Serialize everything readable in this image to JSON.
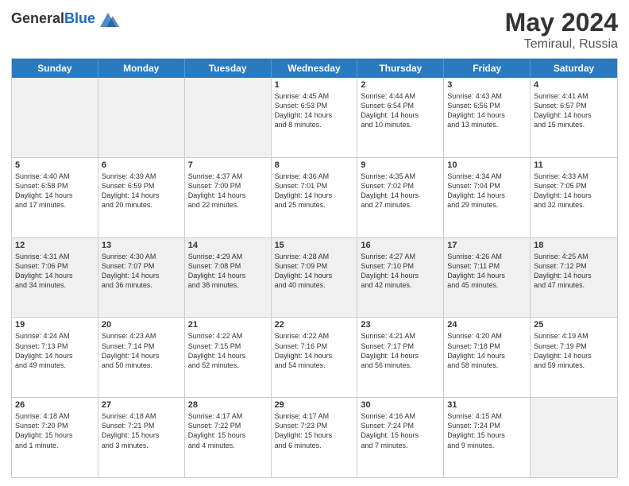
{
  "header": {
    "logo_line1": "General",
    "logo_line2": "Blue",
    "title": "May 2024",
    "location": "Temiraul, Russia"
  },
  "days_of_week": [
    "Sunday",
    "Monday",
    "Tuesday",
    "Wednesday",
    "Thursday",
    "Friday",
    "Saturday"
  ],
  "weeks": [
    [
      {
        "day": "",
        "info": "",
        "shaded": true
      },
      {
        "day": "",
        "info": "",
        "shaded": true
      },
      {
        "day": "",
        "info": "",
        "shaded": true
      },
      {
        "day": "1",
        "info": "Sunrise: 4:45 AM\nSunset: 6:53 PM\nDaylight: 14 hours\nand 8 minutes.",
        "shaded": false
      },
      {
        "day": "2",
        "info": "Sunrise: 4:44 AM\nSunset: 6:54 PM\nDaylight: 14 hours\nand 10 minutes.",
        "shaded": false
      },
      {
        "day": "3",
        "info": "Sunrise: 4:43 AM\nSunset: 6:56 PM\nDaylight: 14 hours\nand 13 minutes.",
        "shaded": false
      },
      {
        "day": "4",
        "info": "Sunrise: 4:41 AM\nSunset: 6:57 PM\nDaylight: 14 hours\nand 15 minutes.",
        "shaded": false
      }
    ],
    [
      {
        "day": "5",
        "info": "Sunrise: 4:40 AM\nSunset: 6:58 PM\nDaylight: 14 hours\nand 17 minutes.",
        "shaded": false
      },
      {
        "day": "6",
        "info": "Sunrise: 4:39 AM\nSunset: 6:59 PM\nDaylight: 14 hours\nand 20 minutes.",
        "shaded": false
      },
      {
        "day": "7",
        "info": "Sunrise: 4:37 AM\nSunset: 7:00 PM\nDaylight: 14 hours\nand 22 minutes.",
        "shaded": false
      },
      {
        "day": "8",
        "info": "Sunrise: 4:36 AM\nSunset: 7:01 PM\nDaylight: 14 hours\nand 25 minutes.",
        "shaded": false
      },
      {
        "day": "9",
        "info": "Sunrise: 4:35 AM\nSunset: 7:02 PM\nDaylight: 14 hours\nand 27 minutes.",
        "shaded": false
      },
      {
        "day": "10",
        "info": "Sunrise: 4:34 AM\nSunset: 7:04 PM\nDaylight: 14 hours\nand 29 minutes.",
        "shaded": false
      },
      {
        "day": "11",
        "info": "Sunrise: 4:33 AM\nSunset: 7:05 PM\nDaylight: 14 hours\nand 32 minutes.",
        "shaded": false
      }
    ],
    [
      {
        "day": "12",
        "info": "Sunrise: 4:31 AM\nSunset: 7:06 PM\nDaylight: 14 hours\nand 34 minutes.",
        "shaded": true
      },
      {
        "day": "13",
        "info": "Sunrise: 4:30 AM\nSunset: 7:07 PM\nDaylight: 14 hours\nand 36 minutes.",
        "shaded": true
      },
      {
        "day": "14",
        "info": "Sunrise: 4:29 AM\nSunset: 7:08 PM\nDaylight: 14 hours\nand 38 minutes.",
        "shaded": true
      },
      {
        "day": "15",
        "info": "Sunrise: 4:28 AM\nSunset: 7:09 PM\nDaylight: 14 hours\nand 40 minutes.",
        "shaded": true
      },
      {
        "day": "16",
        "info": "Sunrise: 4:27 AM\nSunset: 7:10 PM\nDaylight: 14 hours\nand 42 minutes.",
        "shaded": true
      },
      {
        "day": "17",
        "info": "Sunrise: 4:26 AM\nSunset: 7:11 PM\nDaylight: 14 hours\nand 45 minutes.",
        "shaded": true
      },
      {
        "day": "18",
        "info": "Sunrise: 4:25 AM\nSunset: 7:12 PM\nDaylight: 14 hours\nand 47 minutes.",
        "shaded": true
      }
    ],
    [
      {
        "day": "19",
        "info": "Sunrise: 4:24 AM\nSunset: 7:13 PM\nDaylight: 14 hours\nand 49 minutes.",
        "shaded": false
      },
      {
        "day": "20",
        "info": "Sunrise: 4:23 AM\nSunset: 7:14 PM\nDaylight: 14 hours\nand 50 minutes.",
        "shaded": false
      },
      {
        "day": "21",
        "info": "Sunrise: 4:22 AM\nSunset: 7:15 PM\nDaylight: 14 hours\nand 52 minutes.",
        "shaded": false
      },
      {
        "day": "22",
        "info": "Sunrise: 4:22 AM\nSunset: 7:16 PM\nDaylight: 14 hours\nand 54 minutes.",
        "shaded": false
      },
      {
        "day": "23",
        "info": "Sunrise: 4:21 AM\nSunset: 7:17 PM\nDaylight: 14 hours\nand 56 minutes.",
        "shaded": false
      },
      {
        "day": "24",
        "info": "Sunrise: 4:20 AM\nSunset: 7:18 PM\nDaylight: 14 hours\nand 58 minutes.",
        "shaded": false
      },
      {
        "day": "25",
        "info": "Sunrise: 4:19 AM\nSunset: 7:19 PM\nDaylight: 14 hours\nand 59 minutes.",
        "shaded": false
      }
    ],
    [
      {
        "day": "26",
        "info": "Sunrise: 4:18 AM\nSunset: 7:20 PM\nDaylight: 15 hours\nand 1 minute.",
        "shaded": false
      },
      {
        "day": "27",
        "info": "Sunrise: 4:18 AM\nSunset: 7:21 PM\nDaylight: 15 hours\nand 3 minutes.",
        "shaded": false
      },
      {
        "day": "28",
        "info": "Sunrise: 4:17 AM\nSunset: 7:22 PM\nDaylight: 15 hours\nand 4 minutes.",
        "shaded": false
      },
      {
        "day": "29",
        "info": "Sunrise: 4:17 AM\nSunset: 7:23 PM\nDaylight: 15 hours\nand 6 minutes.",
        "shaded": false
      },
      {
        "day": "30",
        "info": "Sunrise: 4:16 AM\nSunset: 7:24 PM\nDaylight: 15 hours\nand 7 minutes.",
        "shaded": false
      },
      {
        "day": "31",
        "info": "Sunrise: 4:15 AM\nSunset: 7:24 PM\nDaylight: 15 hours\nand 9 minutes.",
        "shaded": false
      },
      {
        "day": "",
        "info": "",
        "shaded": true
      }
    ]
  ]
}
